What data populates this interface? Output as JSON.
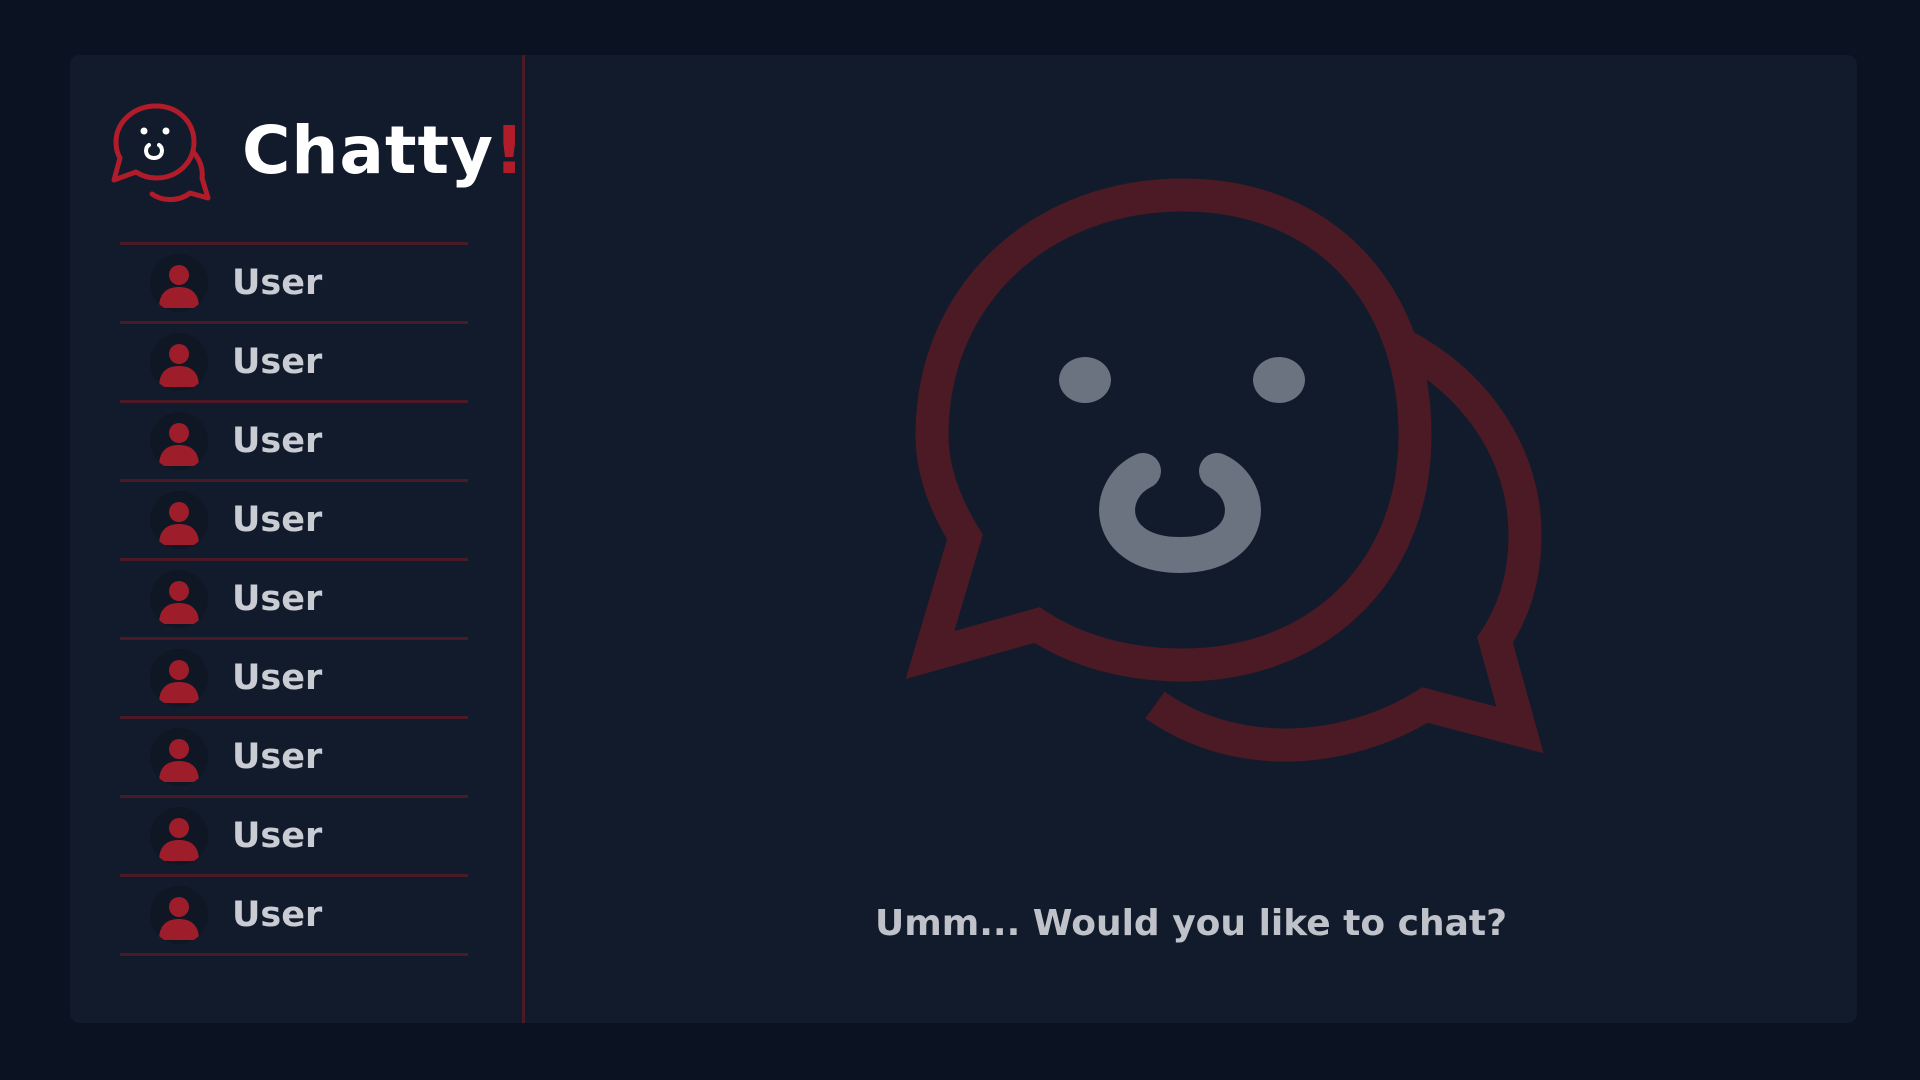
{
  "app": {
    "name": "Chatty",
    "name_suffix": "!",
    "logo_icon": "chat-bubbles-smiley-icon"
  },
  "sidebar": {
    "users": [
      {
        "name": "User",
        "avatar": "user-avatar-icon"
      },
      {
        "name": "User",
        "avatar": "user-avatar-icon"
      },
      {
        "name": "User",
        "avatar": "user-avatar-icon"
      },
      {
        "name": "User",
        "avatar": "user-avatar-icon"
      },
      {
        "name": "User",
        "avatar": "user-avatar-icon"
      },
      {
        "name": "User",
        "avatar": "user-avatar-icon"
      },
      {
        "name": "User",
        "avatar": "user-avatar-icon"
      },
      {
        "name": "User",
        "avatar": "user-avatar-icon"
      },
      {
        "name": "User",
        "avatar": "user-avatar-icon"
      }
    ]
  },
  "main": {
    "empty_state_icon": "chat-bubbles-smiley-icon",
    "prompt": "Umm... Would you like to chat?"
  },
  "colors": {
    "background": "#0b1322",
    "panel": "#121b2c",
    "accent": "#b11c2a",
    "accent_muted": "#4b1a25",
    "text": "#c9ccd3"
  }
}
